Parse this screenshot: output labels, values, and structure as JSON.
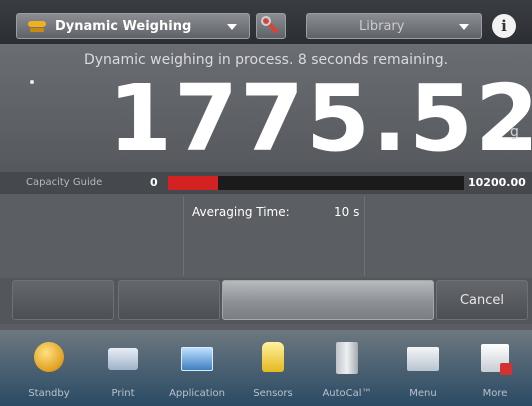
{
  "topbar": {
    "app_label": "Dynamic Weighing",
    "library_label": "Library",
    "info_symbol": "i"
  },
  "display": {
    "status_message": "Dynamic weighing in process. 8 seconds remaining.",
    "weight": "1775.52",
    "unit": "g"
  },
  "capacity_guide": {
    "label": "Capacity Guide",
    "min": "0",
    "max": "10200.00",
    "fill_fraction": 0.17,
    "fill_color": "#d42222"
  },
  "reference": {
    "averaging_time_label": "Averaging Time:",
    "averaging_time_value": "10 s"
  },
  "buttons": {
    "cancel": "Cancel"
  },
  "nav": [
    {
      "label": "Standby",
      "icon": "standby-icon"
    },
    {
      "label": "Print",
      "icon": "printer-icon"
    },
    {
      "label": "Application",
      "icon": "application-icon"
    },
    {
      "label": "Sensors",
      "icon": "sensors-icon"
    },
    {
      "label": "AutoCal™",
      "icon": "autocal-icon"
    },
    {
      "label": "Menu",
      "icon": "menu-icon"
    },
    {
      "label": "More",
      "icon": "more-icon"
    }
  ]
}
